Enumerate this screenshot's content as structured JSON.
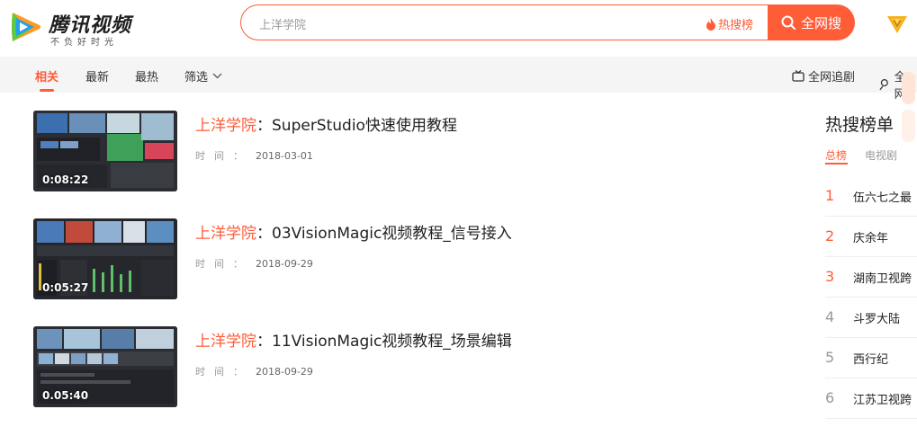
{
  "brand": {
    "name": "腾讯视频",
    "slogan": "不负好时光",
    "colors": {
      "accent": "#ff5c38",
      "logo_orange": "#ff9a1e",
      "logo_green": "#5ecb3c",
      "logo_blue": "#21a0f0"
    }
  },
  "search": {
    "query": "上洋学院",
    "hot_label": "热搜榜",
    "button_label": "全网搜"
  },
  "subnav": {
    "tabs": [
      {
        "label": "相关",
        "active": true
      },
      {
        "label": "最新"
      },
      {
        "label": "最热"
      },
      {
        "label": "筛选"
      }
    ],
    "right": [
      {
        "label": "全网追剧",
        "icon": "tv-icon"
      },
      {
        "label": "全网",
        "icon": "person-search-icon"
      }
    ]
  },
  "results": [
    {
      "title_highlight": "上洋学院",
      "title_sep": "：",
      "title_rest": "SuperStudio快速使用教程",
      "meta_label": "时间：",
      "date": "2018-03-01",
      "duration": "0:08:22"
    },
    {
      "title_highlight": "上洋学院",
      "title_sep": "：",
      "title_rest": "03VisionMagic视频教程_信号接入",
      "meta_label": "时间：",
      "date": "2018-09-29",
      "duration": "0:05:27"
    },
    {
      "title_highlight": "上洋学院",
      "title_sep": "：",
      "title_rest": "11VisionMagic视频教程_场景编辑",
      "meta_label": "时间：",
      "date": "2018-09-29",
      "duration": "0.05:40"
    }
  ],
  "hot_list": {
    "title": "热搜榜单",
    "tabs": [
      "总榜",
      "电视剧"
    ],
    "items": [
      {
        "rank": "1",
        "name": "伍六七之最"
      },
      {
        "rank": "2",
        "name": "庆余年"
      },
      {
        "rank": "3",
        "name": "湖南卫视跨"
      },
      {
        "rank": "4",
        "name": "斗罗大陆"
      },
      {
        "rank": "5",
        "name": "西行纪"
      },
      {
        "rank": "6",
        "name": "江苏卫视跨"
      }
    ]
  }
}
